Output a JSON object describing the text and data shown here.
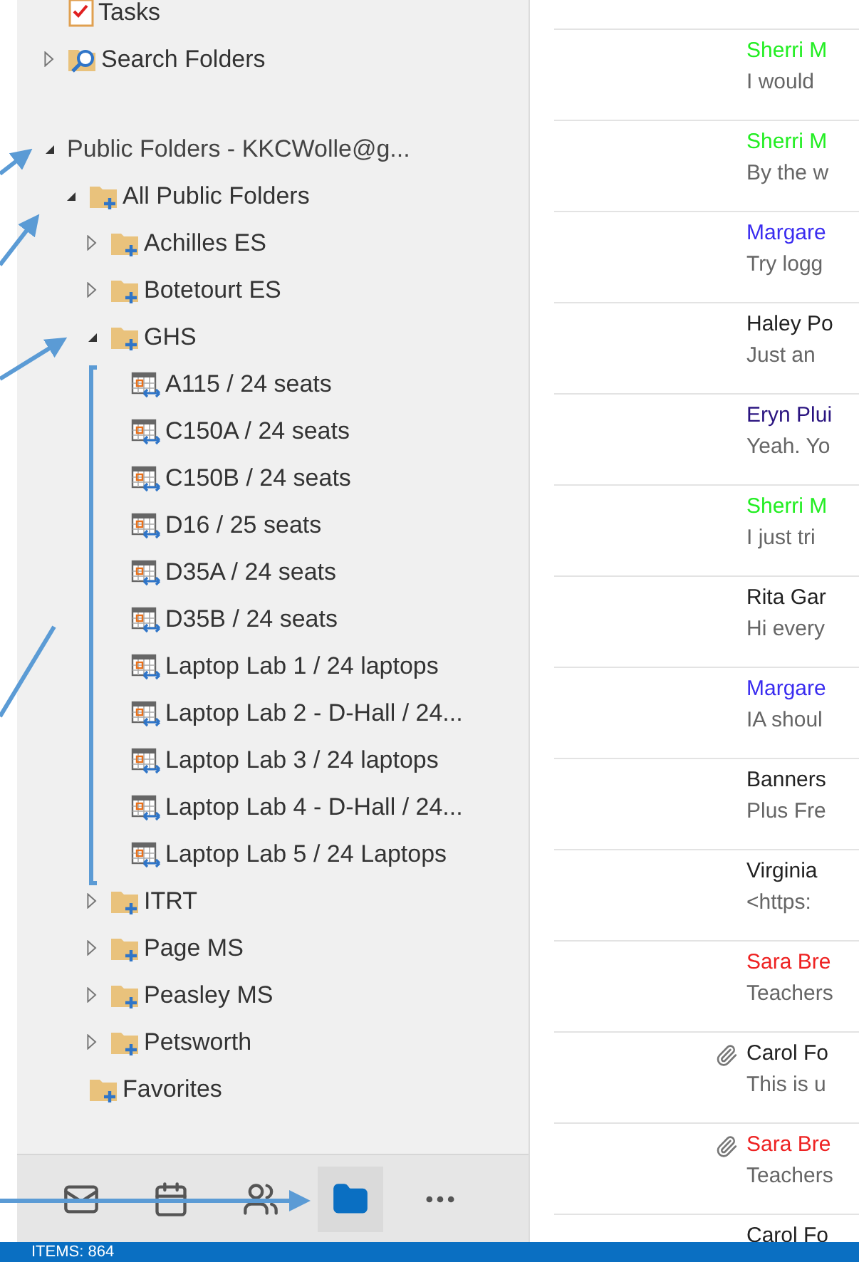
{
  "folder_tree": [
    {
      "kind": "tasks",
      "label": "Tasks"
    },
    {
      "kind": "search",
      "label": "Search Folders",
      "expanded": false
    },
    {
      "kind": "account",
      "label": "Public Folders - KKCWolle@g...",
      "expanded": true,
      "children": [
        {
          "kind": "folder",
          "label": "All Public Folders",
          "expanded": true,
          "children": [
            {
              "kind": "folder",
              "label": "Achilles ES",
              "expanded": false
            },
            {
              "kind": "folder",
              "label": "Botetourt ES",
              "expanded": false
            },
            {
              "kind": "folder",
              "label": "GHS",
              "expanded": true,
              "children": [
                {
                  "kind": "calendar",
                  "label": "A115 / 24 seats"
                },
                {
                  "kind": "calendar",
                  "label": "C150A / 24 seats"
                },
                {
                  "kind": "calendar",
                  "label": "C150B / 24 seats"
                },
                {
                  "kind": "calendar",
                  "label": "D16 / 25 seats"
                },
                {
                  "kind": "calendar",
                  "label": "D35A / 24 seats"
                },
                {
                  "kind": "calendar",
                  "label": "D35B / 24 seats"
                },
                {
                  "kind": "calendar",
                  "label": "Laptop Lab 1 / 24 laptops"
                },
                {
                  "kind": "calendar",
                  "label": "Laptop Lab 2 - D-Hall / 24..."
                },
                {
                  "kind": "calendar",
                  "label": "Laptop Lab 3 / 24 laptops"
                },
                {
                  "kind": "calendar",
                  "label": "Laptop Lab 4 - D-Hall / 24..."
                },
                {
                  "kind": "calendar",
                  "label": "Laptop Lab 5 / 24 Laptops"
                }
              ]
            },
            {
              "kind": "folder",
              "label": "ITRT",
              "expanded": false
            },
            {
              "kind": "folder",
              "label": "Page MS",
              "expanded": false
            },
            {
              "kind": "folder",
              "label": "Peasley MS",
              "expanded": false
            },
            {
              "kind": "folder",
              "label": "Petsworth",
              "expanded": false
            }
          ]
        },
        {
          "kind": "folder",
          "label": "Favorites"
        }
      ]
    }
  ],
  "nav_bar": [
    {
      "kind": "mail",
      "selected": false
    },
    {
      "kind": "calendar",
      "selected": false
    },
    {
      "kind": "people",
      "selected": false
    },
    {
      "kind": "folders",
      "selected": true
    },
    {
      "kind": "more",
      "selected": false
    }
  ],
  "messages": [
    {
      "sender": "Sherri M",
      "color": "#22ee22",
      "preview": "I would",
      "attachment": false
    },
    {
      "sender": "Sherri M",
      "color": "#22ee22",
      "preview": "By the w",
      "attachment": false
    },
    {
      "sender": "Margare",
      "color": "#3a2cf0",
      "preview": "Try logg",
      "attachment": false
    },
    {
      "sender": "Haley Po",
      "color": "#222222",
      "preview": "Just an",
      "attachment": false
    },
    {
      "sender": "Eryn Plui",
      "color": "#2a1480",
      "preview": "Yeah. Yo",
      "attachment": false
    },
    {
      "sender": "Sherri M",
      "color": "#22ee22",
      "preview": "I just tri",
      "attachment": false
    },
    {
      "sender": "Rita Gar",
      "color": "#222222",
      "preview": "Hi every",
      "attachment": false
    },
    {
      "sender": "Margare",
      "color": "#3a2cf0",
      "preview": "IA shoul",
      "attachment": false
    },
    {
      "sender": "Banners",
      "color": "#222222",
      "preview": "Plus Fre",
      "attachment": false
    },
    {
      "sender": "Virginia",
      "color": "#222222",
      "preview": "<https:",
      "attachment": false
    },
    {
      "sender": "Sara Bre",
      "color": "#ee2222",
      "preview": "Teachers",
      "attachment": false
    },
    {
      "sender": "Carol Fo",
      "color": "#222222",
      "preview": "This is u",
      "attachment": true
    },
    {
      "sender": "Sara Bre",
      "color": "#ee2222",
      "preview": "Teachers",
      "attachment": true
    },
    {
      "sender": "Carol Fo",
      "color": "#222222",
      "attachment": false
    }
  ],
  "status_bar": {
    "text": "ITEMS: 864"
  }
}
